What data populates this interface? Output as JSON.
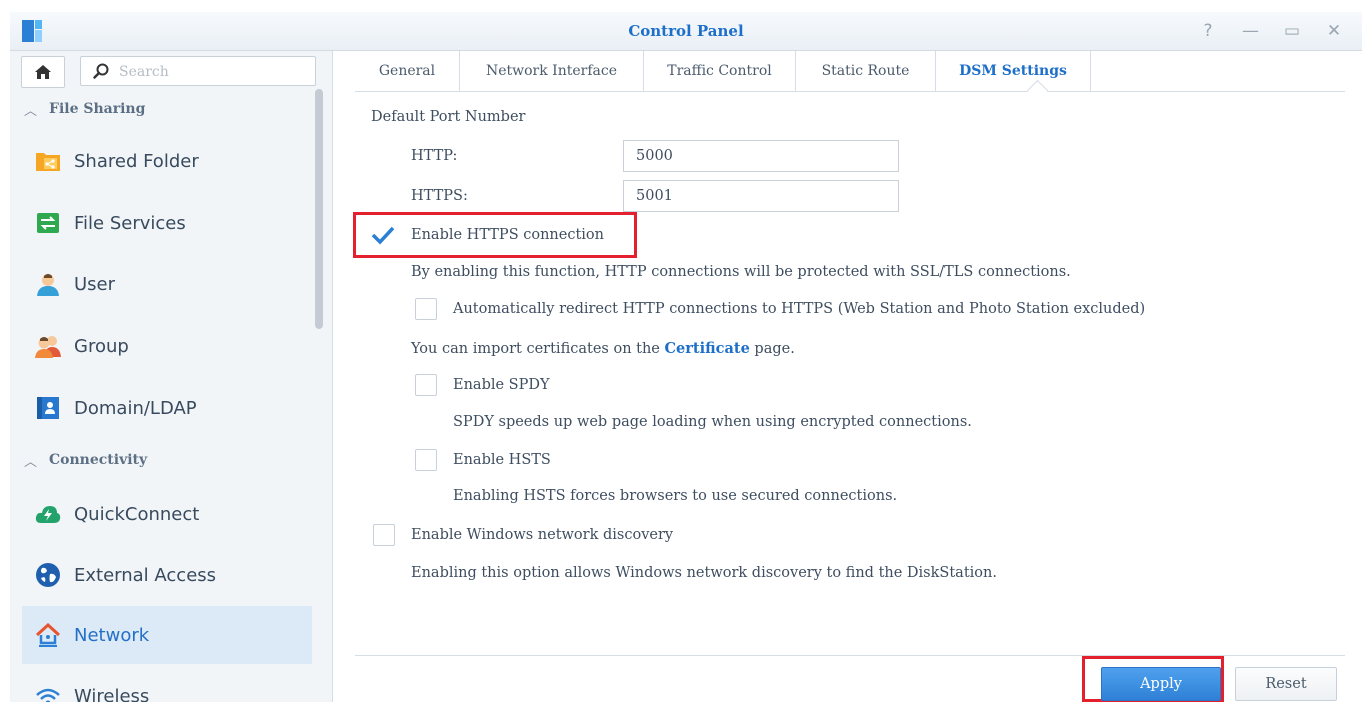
{
  "window": {
    "title": "Control Panel",
    "controls": [
      {
        "name": "help-icon",
        "glyph": "?"
      },
      {
        "name": "minimize-icon",
        "glyph": "—"
      },
      {
        "name": "maximize-icon",
        "glyph": "▭"
      },
      {
        "name": "close-icon",
        "glyph": "✕"
      }
    ]
  },
  "sidebar": {
    "search_placeholder": "Search",
    "sections": [
      {
        "label": "File Sharing",
        "chevron": "︿"
      },
      {
        "label": "Connectivity",
        "chevron": "︿"
      }
    ],
    "items": [
      {
        "label": "Shared Folder",
        "icon": "shared-folder-icon"
      },
      {
        "label": "File Services",
        "icon": "file-services-icon"
      },
      {
        "label": "User",
        "icon": "user-icon"
      },
      {
        "label": "Group",
        "icon": "group-icon"
      },
      {
        "label": "Domain/LDAP",
        "icon": "domain-ldap-icon"
      },
      {
        "label": "QuickConnect",
        "icon": "quickconnect-icon"
      },
      {
        "label": "External Access",
        "icon": "external-access-icon"
      },
      {
        "label": "Network",
        "icon": "network-icon",
        "active": true
      },
      {
        "label": "Wireless",
        "icon": "wireless-icon"
      }
    ]
  },
  "tabs": [
    "General",
    "Network Interface",
    "Traffic Control",
    "Static Route",
    "DSM Settings"
  ],
  "active_tab": "DSM Settings",
  "settings": {
    "port_heading": "Default Port Number",
    "http_label": "HTTP:",
    "http_value": "5000",
    "https_label": "HTTPS:",
    "https_value": "5001",
    "enable_https": {
      "label": "Enable HTTPS connection",
      "checked": true
    },
    "https_desc": "By enabling this function, HTTP connections will be protected with SSL/TLS connections.",
    "redirect": {
      "label": "Automatically redirect HTTP connections to HTTPS (Web Station and Photo Station excluded)",
      "checked": false
    },
    "cert_text_before": "You can import certificates on the",
    "cert_link": "Certificate",
    "cert_text_after": "page.",
    "spdy": {
      "label": "Enable SPDY",
      "checked": false
    },
    "spdy_desc": "SPDY speeds up web page loading when using encrypted connections.",
    "hsts": {
      "label": "Enable HSTS",
      "checked": false
    },
    "hsts_desc": "Enabling HSTS forces browsers to use secured connections.",
    "win_discovery": {
      "label": "Enable Windows network discovery",
      "checked": false
    },
    "win_discovery_desc": "Enabling this option allows Windows network discovery to find the DiskStation."
  },
  "footer": {
    "apply_label": "Apply",
    "reset_label": "Reset"
  },
  "colors": {
    "accent": "#1e6fc9",
    "highlight_box": "#e4202e",
    "active_nav_bg": "#dce9f7"
  }
}
